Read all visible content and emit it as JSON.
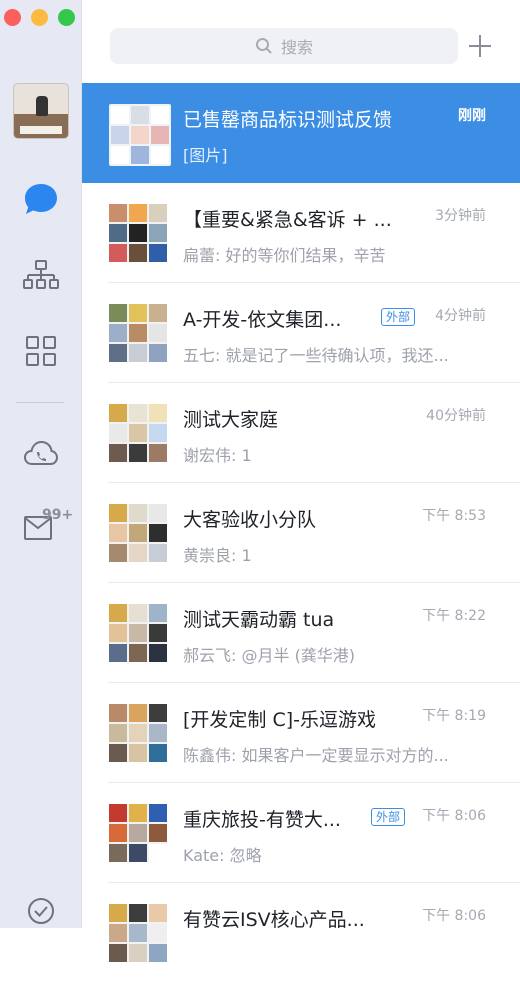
{
  "sidebar": {
    "badge": "99+",
    "icons": [
      "message-icon",
      "org-chart-icon",
      "workbench-grid-icon",
      "cloud-phone-icon",
      "mail-icon",
      "check-circle-icon"
    ],
    "accent": "#2c86ef"
  },
  "search": {
    "placeholder": "搜索"
  },
  "conversations": [
    {
      "title": "已售罄商品标识测试反馈",
      "sub": "[图片]",
      "time": "刚刚",
      "ext": ""
    },
    {
      "title": "【重要&紧急&客诉 + ...",
      "sub": "扁蕾: 好的等你们结果，辛苦",
      "time": "3分钟前",
      "ext": ""
    },
    {
      "title": "A-开发-依文集团...",
      "sub": "五七: 就是记了一些待确认项，我还...",
      "time": "4分钟前",
      "ext": "外部"
    },
    {
      "title": "测试大家庭",
      "sub": "谢宏伟: 1",
      "time": "40分钟前",
      "ext": ""
    },
    {
      "title": "大客验收小分队",
      "sub": "黄崇良: 1",
      "time": "下午 8:53",
      "ext": ""
    },
    {
      "title": "测试天霸动霸 tua",
      "sub": "郝云飞: @月半 (龚华港)",
      "time": "下午 8:22",
      "ext": ""
    },
    {
      "title": "[开发定制 C]-乐逗游戏",
      "sub": "陈鑫伟: 如果客户一定要显示对方的...",
      "time": "下午 8:19",
      "ext": ""
    },
    {
      "title": "重庆旅投-有赞大...",
      "sub": "Kate: 忽略",
      "time": "下午 8:06",
      "ext": "外部"
    },
    {
      "title": "有赞云ISV核心产品...",
      "sub": "",
      "time": "下午 8:06",
      "ext": ""
    }
  ]
}
